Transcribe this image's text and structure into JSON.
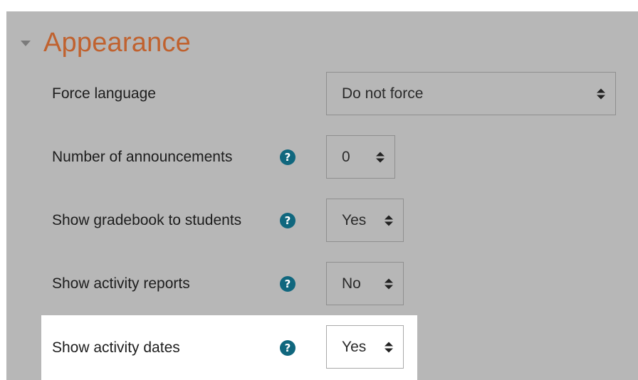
{
  "section": {
    "title": "Appearance",
    "caret_icon": "caret-down-icon"
  },
  "settings": [
    {
      "label": "Force language",
      "value": "Do not force",
      "has_help": false
    },
    {
      "label": "Number of announcements",
      "value": "0",
      "has_help": true
    },
    {
      "label": "Show gradebook to students",
      "value": "Yes",
      "has_help": true
    },
    {
      "label": "Show activity reports",
      "value": "No",
      "has_help": true
    },
    {
      "label": "Show activity dates",
      "value": "Yes",
      "has_help": true,
      "highlighted": true
    }
  ],
  "help_icon": {
    "glyph": "?",
    "color": "#10677e"
  },
  "colors": {
    "panel_bg": "#b7b7b7",
    "title": "#c0622f",
    "highlight_bg": "#ffffff"
  }
}
